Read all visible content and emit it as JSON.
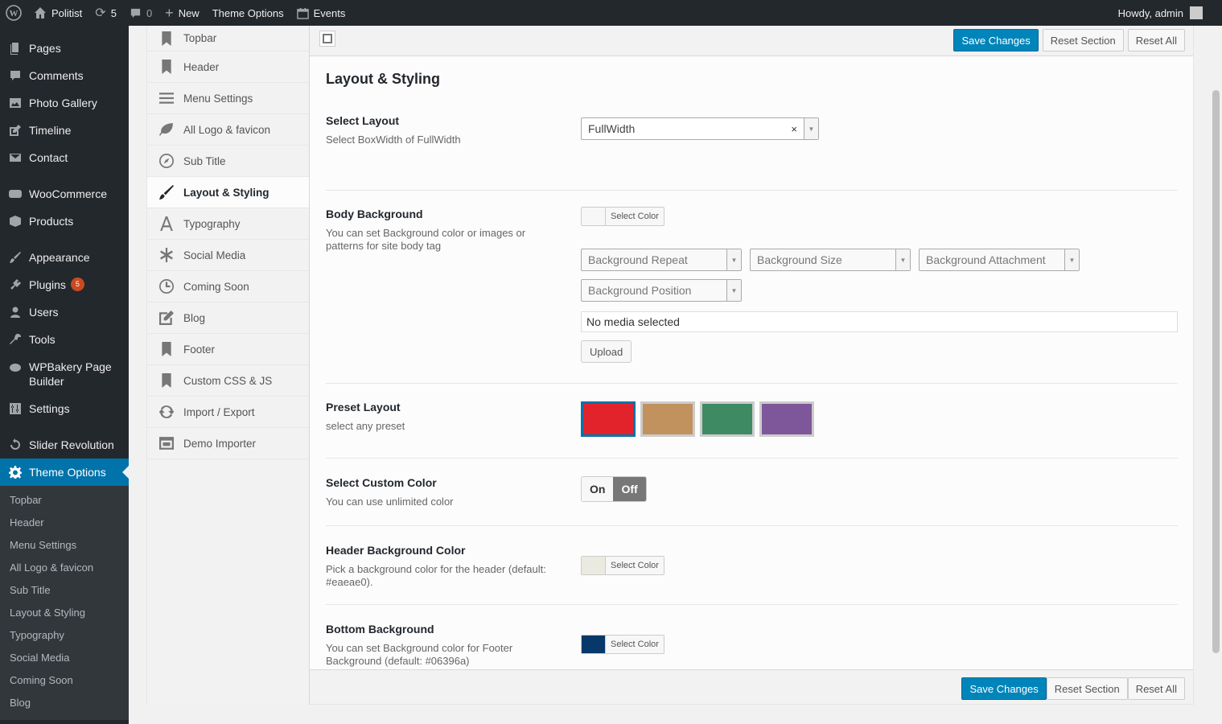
{
  "adminbar": {
    "site_name": "Politist",
    "updates": "5",
    "comments": "0",
    "new": "New",
    "theme_options": "Theme Options",
    "events": "Events",
    "howdy": "Howdy, admin"
  },
  "menu": {
    "pages": "Pages",
    "comments": "Comments",
    "photo_gallery": "Photo Gallery",
    "timeline": "Timeline",
    "contact": "Contact",
    "woocommerce": "WooCommerce",
    "products": "Products",
    "appearance": "Appearance",
    "plugins": "Plugins",
    "plugins_badge": "5",
    "users": "Users",
    "tools": "Tools",
    "wpbakery": "WPBakery Page Builder",
    "settings": "Settings",
    "slider_revolution": "Slider Revolution",
    "theme_options": "Theme Options",
    "submenu": [
      "Topbar",
      "Header",
      "Menu Settings",
      "All Logo & favicon",
      "Sub Title",
      "Layout & Styling",
      "Typography",
      "Social Media",
      "Coming Soon",
      "Blog"
    ]
  },
  "sections": [
    "Topbar",
    "Header",
    "Menu Settings",
    "All Logo & favicon",
    "Sub Title",
    "Layout & Styling",
    "Typography",
    "Social Media",
    "Coming Soon",
    "Blog",
    "Footer",
    "Custom CSS & JS",
    "Import / Export",
    "Demo Importer"
  ],
  "buttons": {
    "save": "Save Changes",
    "reset_section": "Reset Section",
    "reset_all": "Reset All"
  },
  "page": {
    "title": "Layout & Styling",
    "select_layout": {
      "title": "Select Layout",
      "desc": "Select BoxWidth of FullWidth",
      "value": "FullWidth"
    },
    "body_background": {
      "title": "Body Background",
      "desc": "You can set Background color or images or patterns for site body tag",
      "select_color": "Select Color",
      "repeat": "Background Repeat",
      "size": "Background Size",
      "attachment": "Background Attachment",
      "position": "Background Position",
      "media": "No media selected",
      "upload": "Upload",
      "swatch": "#f7f7f7"
    },
    "preset_layout": {
      "title": "Preset Layout",
      "desc": "select any preset",
      "colors": [
        "#e3232b",
        "#c1915e",
        "#3e8a63",
        "#7e579a"
      ]
    },
    "custom_color": {
      "title": "Select Custom Color",
      "desc": "You can use unlimited color",
      "on": "On",
      "off": "Off"
    },
    "header_bg": {
      "title": "Header Background Color",
      "desc": "Pick a background color for the header (default: #eaeae0).",
      "select_color": "Select Color",
      "swatch": "#eaeae0"
    },
    "bottom_bg": {
      "title": "Bottom Background",
      "desc": "You can set Background color for Footer Background (default: #06396a)",
      "select_color": "Select Color",
      "swatch": "#06396a"
    }
  }
}
